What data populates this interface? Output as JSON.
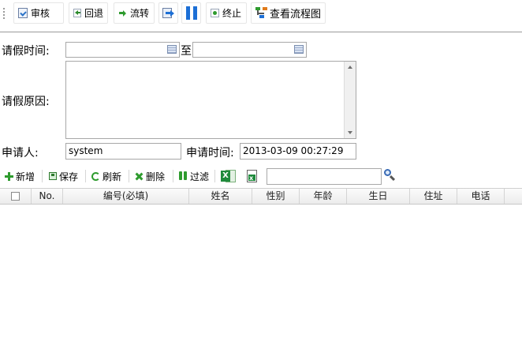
{
  "toolbar": {
    "audit_label": "审核",
    "return_label": "回退",
    "transfer_label": "流转",
    "terminate_label": "终止",
    "view_flow_label": "查看流程图"
  },
  "form": {
    "leave_time_label": "请假时间:",
    "to_label": "至",
    "start_time": "",
    "end_time": "",
    "reason_label": "请假原因:",
    "reason": "",
    "applicant_label": "申请人:",
    "applicant": "system",
    "apply_time_label": "申请时间:",
    "apply_time": "2013-03-09 00:27:29"
  },
  "grid_toolbar": {
    "add_label": "新增",
    "save_label": "保存",
    "refresh_label": "刷新",
    "delete_label": "删除",
    "filter_label": "过滤",
    "search_value": ""
  },
  "grid": {
    "columns": [
      "No.",
      "编号(必填)",
      "姓名",
      "性别",
      "年龄",
      "生日",
      "住址",
      "电话"
    ]
  },
  "icons": {
    "audit": "document-check-icon",
    "return": "back-icon",
    "transfer": "forward-arrow-icon",
    "submit": "document-arrow-icon",
    "pause": "pause-icon",
    "terminate": "stop-icon",
    "flow": "flowchart-icon",
    "calendar": "calendar-icon",
    "excel": "excel-icon",
    "export": "export-icon",
    "search": "magnifier-icon"
  },
  "colors": {
    "accent_blue": "#1c6fd6",
    "green": "#2e9b2e",
    "toolbar_border": "#9a9a9a"
  }
}
